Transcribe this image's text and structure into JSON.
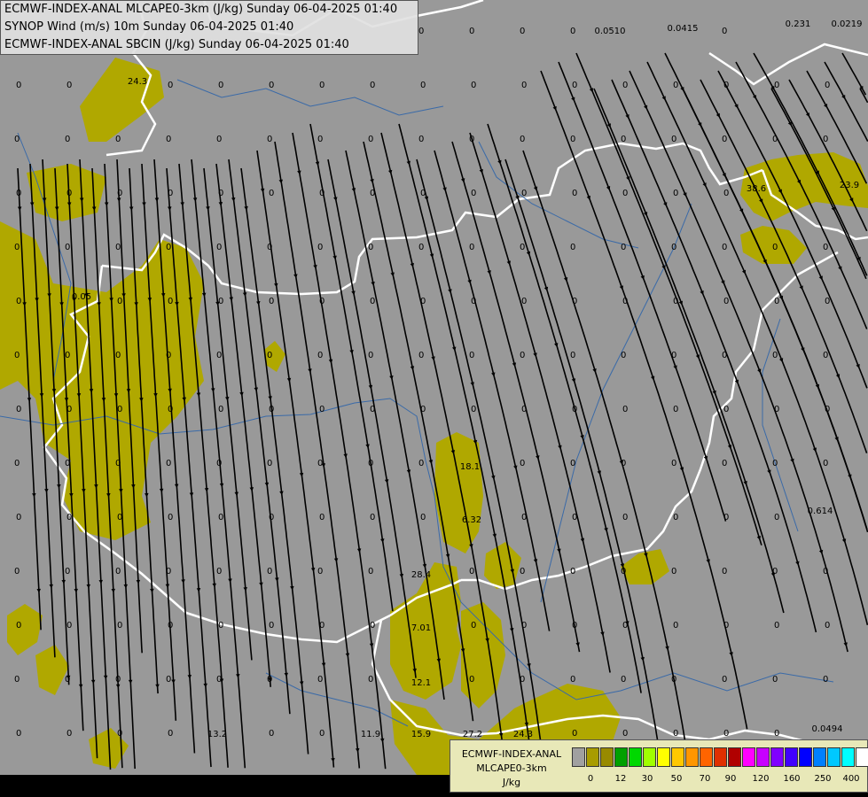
{
  "titles": [
    "ECMWF-INDEX-ANAL MLCAPE0-3km (J/kg) Sunday 06-04-2025 01:40",
    "SYNOP Wind (m/s) 10m Sunday 06-04-2025 01:40",
    "ECMWF-INDEX-ANAL SBCIN (J/kg) Sunday 06-04-2025 01:40"
  ],
  "legend": {
    "line1": "ECMWF-INDEX-ANAL",
    "line2": "MLCAPE0-3km",
    "unit": "J/kg",
    "tick_labels": [
      "0",
      "12",
      "30",
      "50",
      "70",
      "90",
      "120",
      "160",
      "250",
      "400"
    ],
    "colors": [
      "#a0a0a0",
      "#a89c00",
      "#988a00",
      "#00a000",
      "#00d800",
      "#a0ff00",
      "#ffff00",
      "#ffc800",
      "#ff9600",
      "#ff6400",
      "#e03000",
      "#b00000",
      "#ff00ff",
      "#c800ff",
      "#8000ff",
      "#4000ff",
      "#0000ff",
      "#0080ff",
      "#00c8ff",
      "#00ffff",
      "#ffffff"
    ]
  },
  "colors": {
    "background": "#999999",
    "cape_fill": "#b0a800",
    "borders": "#ffffff",
    "rivers": "#3a6aa8",
    "streamlines": "#000000"
  },
  "cape_labels": [
    "24.3",
    "38.6",
    "38.6",
    "23.9",
    "18.1",
    "6.32",
    "28.4",
    "7.01",
    "12.1",
    "13.2",
    "11.9",
    "15.9",
    "27.2",
    "24.3",
    "0.614",
    "0.0494",
    "0.231",
    "0.0219",
    "0.0415",
    "0.0510",
    "0.05"
  ],
  "zero_label": "0"
}
